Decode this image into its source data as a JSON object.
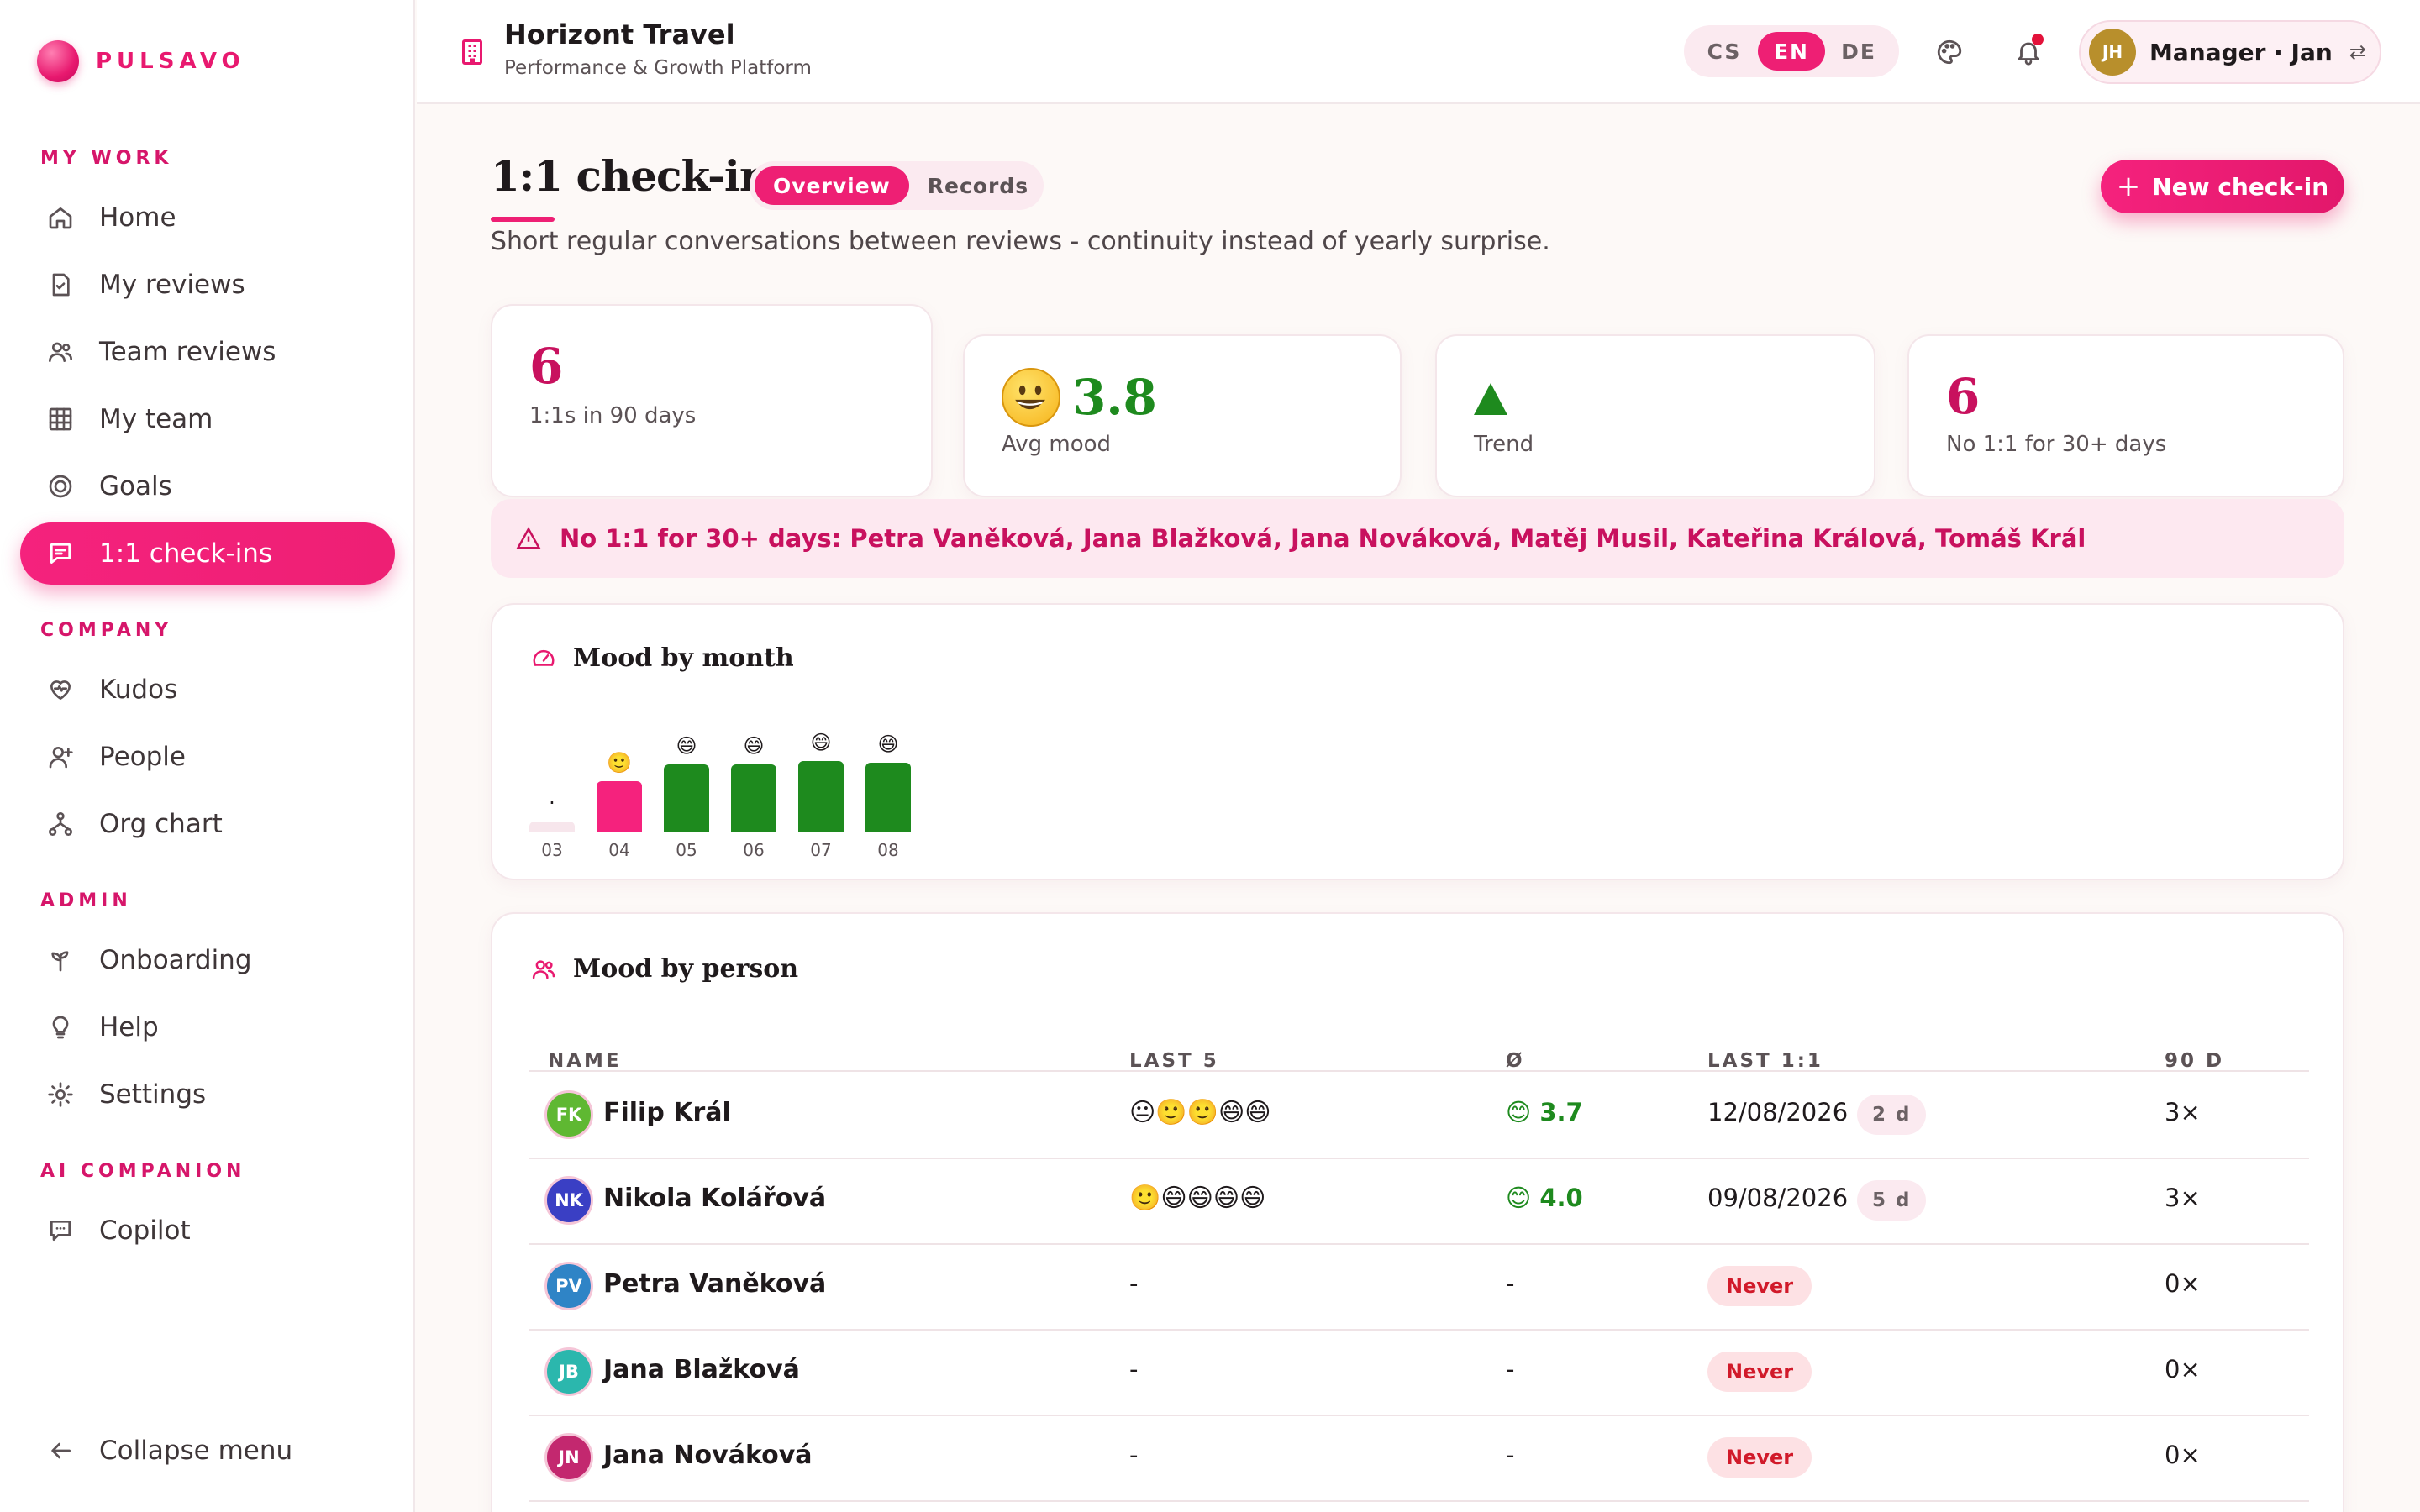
{
  "brand": {
    "name": "PULSAVO"
  },
  "sidebar": {
    "sections": [
      {
        "label": "MY WORK"
      },
      {
        "label": "COMPANY"
      },
      {
        "label": "ADMIN"
      },
      {
        "label": "AI COMPANION"
      }
    ],
    "items": [
      {
        "label": "Home",
        "icon": "home-icon"
      },
      {
        "label": "My reviews",
        "icon": "document-check-icon"
      },
      {
        "label": "Team reviews",
        "icon": "users-icon"
      },
      {
        "label": "My team",
        "icon": "grid-icon"
      },
      {
        "label": "Goals",
        "icon": "target-icon"
      },
      {
        "label": "1:1 check-ins",
        "icon": "chat-icon",
        "active": true
      },
      {
        "label": "Kudos",
        "icon": "heart-icon"
      },
      {
        "label": "People",
        "icon": "user-plus-icon"
      },
      {
        "label": "Org chart",
        "icon": "org-chart-icon"
      },
      {
        "label": "Onboarding",
        "icon": "sprout-icon"
      },
      {
        "label": "Help",
        "icon": "lightbulb-icon"
      },
      {
        "label": "Settings",
        "icon": "gear-icon"
      },
      {
        "label": "Copilot",
        "icon": "chat-bubble-icon"
      }
    ],
    "collapse_label": "Collapse menu"
  },
  "header": {
    "org_name": "Horizont Travel",
    "org_subtitle": "Performance & Growth Platform",
    "languages": [
      "CS",
      "EN",
      "DE"
    ],
    "active_language": "EN",
    "user_initials": "JH",
    "user_label": "Manager · Jan",
    "swap_icon": "⇄"
  },
  "page": {
    "title": "1:1 check-ins",
    "tabs": [
      "Overview",
      "Records"
    ],
    "active_tab": "Overview",
    "subtitle": "Short regular conversations between reviews - continuity instead of yearly surprise.",
    "new_button": "New check-in",
    "plus": "+"
  },
  "stats": [
    {
      "value": "6",
      "label": "1:1s in 90 days",
      "color": "#c8115e"
    },
    {
      "value": "3.8",
      "label": "Avg mood",
      "color": "#1e8a1e"
    },
    {
      "value": "",
      "label": "Trend",
      "color": "#1e8a1e"
    },
    {
      "value": "6",
      "label": "No 1:1 for 30+ days",
      "color": "#c8115e"
    }
  ],
  "alert": {
    "text": "No 1:1 for 30+ days: Petra Vaněková, Jana Blažková, Jana Nováková, Matěj Musil, Kateřina Králová, Tomáš Král"
  },
  "mood_chart": {
    "title": "Mood by month"
  },
  "chart_data": {
    "type": "bar",
    "categories": [
      "03",
      "04",
      "05",
      "06",
      "07",
      "08"
    ],
    "values": [
      0,
      3,
      4,
      4,
      4.2,
      4.1
    ],
    "labels": [
      "·",
      "🙂",
      "😄",
      "😄",
      "😄",
      "😄"
    ],
    "colors": [
      "#f7e6ec",
      "#f5227d",
      "#1e8a1e",
      "#1e8a1e",
      "#1e8a1e",
      "#1e8a1e"
    ],
    "ylim": [
      0,
      5
    ]
  },
  "mood_table": {
    "title": "Mood by person",
    "columns": [
      "NAME",
      "LAST 5",
      "Ø",
      "LAST 1:1",
      "90 D"
    ],
    "rows": [
      {
        "initials": "FK",
        "color": "#5fb832",
        "name": "Filip Král",
        "last5": "😐🙂🙂😄😄",
        "avg": "😊 3.7",
        "last": "12/08/2026",
        "days": "2 d",
        "count": "3×"
      },
      {
        "initials": "NK",
        "color": "#3a3fc4",
        "name": "Nikola Kolářová",
        "last5": "🙂😄😄😄😄",
        "avg": "😊 4.0",
        "last": "09/08/2026",
        "days": "5 d",
        "count": "3×"
      },
      {
        "initials": "PV",
        "color": "#2f84c6",
        "name": "Petra Vaněková",
        "last5": "-",
        "avg": "-",
        "last": "Never",
        "days": "",
        "count": "0×"
      },
      {
        "initials": "JB",
        "color": "#2bb7ad",
        "name": "Jana Blažková",
        "last5": "-",
        "avg": "-",
        "last": "Never",
        "days": "",
        "count": "0×"
      },
      {
        "initials": "JN",
        "color": "#c3286f",
        "name": "Jana Nováková",
        "last5": "-",
        "avg": "-",
        "last": "Never",
        "days": "",
        "count": "0×"
      }
    ]
  }
}
